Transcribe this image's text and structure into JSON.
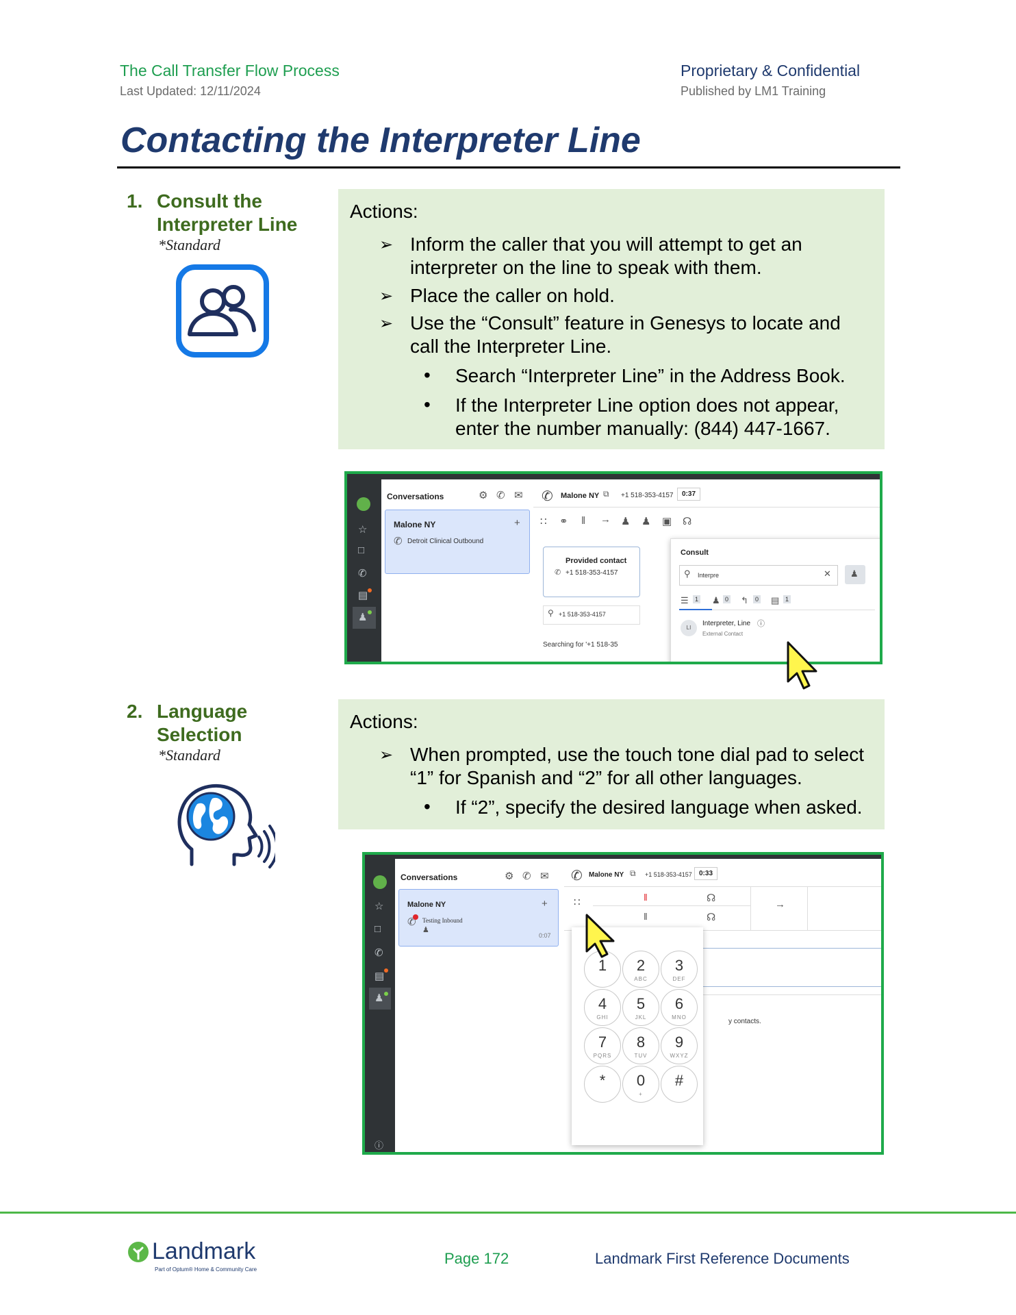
{
  "header": {
    "left_title": "The Call Transfer Flow Process",
    "left_sub": "Last Updated: 12/11/2024",
    "right_title": "Proprietary & Confidential",
    "right_sub": "Published by LM1 Training"
  },
  "page_title": "Contacting the Interpreter Line",
  "steps": [
    {
      "number": "1.",
      "title_line1": "Consult the",
      "title_line2": "Interpreter Line",
      "standard": "*Standard",
      "icon": "consult-people-icon",
      "actions_label": "Actions:",
      "arrows": [
        [
          "Inform the caller that you will attempt to get an",
          "interpreter on the line to speak with them."
        ],
        [
          "Place the caller on hold."
        ],
        [
          "Use the “Consult” feature in Genesys to locate and",
          "call the Interpreter Line."
        ]
      ],
      "bullets": [
        [
          "Search “Interpreter Line” in the Address Book."
        ],
        [
          "If the Interpreter Line option does not appear,",
          "enter the number manually: (844) 447-1667."
        ]
      ]
    },
    {
      "number": "2.",
      "title_line1": "Language",
      "title_line2": "Selection",
      "standard": "*Standard",
      "icon": "language-speaking-head-icon",
      "actions_label": "Actions:",
      "arrows": [
        [
          "When prompted, use the touch tone dial pad to select",
          "“1” for Spanish and “2” for all other languages."
        ]
      ],
      "bullets": [
        [
          "If “2”, specify the desired language when asked."
        ]
      ]
    }
  ],
  "screenshot1": {
    "conversations_label": "Conversations",
    "card_name": "Malone NY",
    "card_sub": "Detroit Clinical Outbound",
    "call_name": "Malone NY",
    "call_number": "+1 518-353-4157",
    "call_timer": "0:37",
    "provided_contact": "Provided contact",
    "provided_number": "+1 518-353-4157",
    "search_number": "+1 518-353-4157",
    "searching_text": "Searching for '+1 518-35",
    "consult_label": "Consult",
    "consult_search_value": "Interpre",
    "filter_counts": [
      "1",
      "0",
      "0",
      "1"
    ],
    "result_initials": "LI",
    "result_name": "Interpreter, Line",
    "result_type": "External Contact"
  },
  "screenshot2": {
    "conversations_label": "Conversations",
    "card_name": "Malone NY",
    "card_sub": "Testing Inbound",
    "card_time": "0:07",
    "call_name": "Malone NY",
    "call_number": "+1 518-353-4157",
    "call_timer": "0:33",
    "contacts_text": "y contacts.",
    "keys": [
      {
        "d": "1",
        "l": ""
      },
      {
        "d": "2",
        "l": "ABC"
      },
      {
        "d": "3",
        "l": "DEF"
      },
      {
        "d": "4",
        "l": "GHI"
      },
      {
        "d": "5",
        "l": "JKL"
      },
      {
        "d": "6",
        "l": "MNO"
      },
      {
        "d": "7",
        "l": "PQRS"
      },
      {
        "d": "8",
        "l": "TUV"
      },
      {
        "d": "9",
        "l": "WXYZ"
      },
      {
        "d": "*",
        "l": ""
      },
      {
        "d": "0",
        "l": "+"
      },
      {
        "d": "#",
        "l": ""
      }
    ]
  },
  "footer": {
    "logo_text": "Landmark",
    "logo_sub": "Part of Optum® Home & Community Care",
    "page": "Page 172",
    "doc": "Landmark First Reference Documents"
  },
  "colors": {
    "green_text": "#1e9e50",
    "navy": "#1f3a6e",
    "step_green": "#3e6b1f",
    "action_bg": "#e2efd9",
    "frame_green": "#1faa4b"
  }
}
